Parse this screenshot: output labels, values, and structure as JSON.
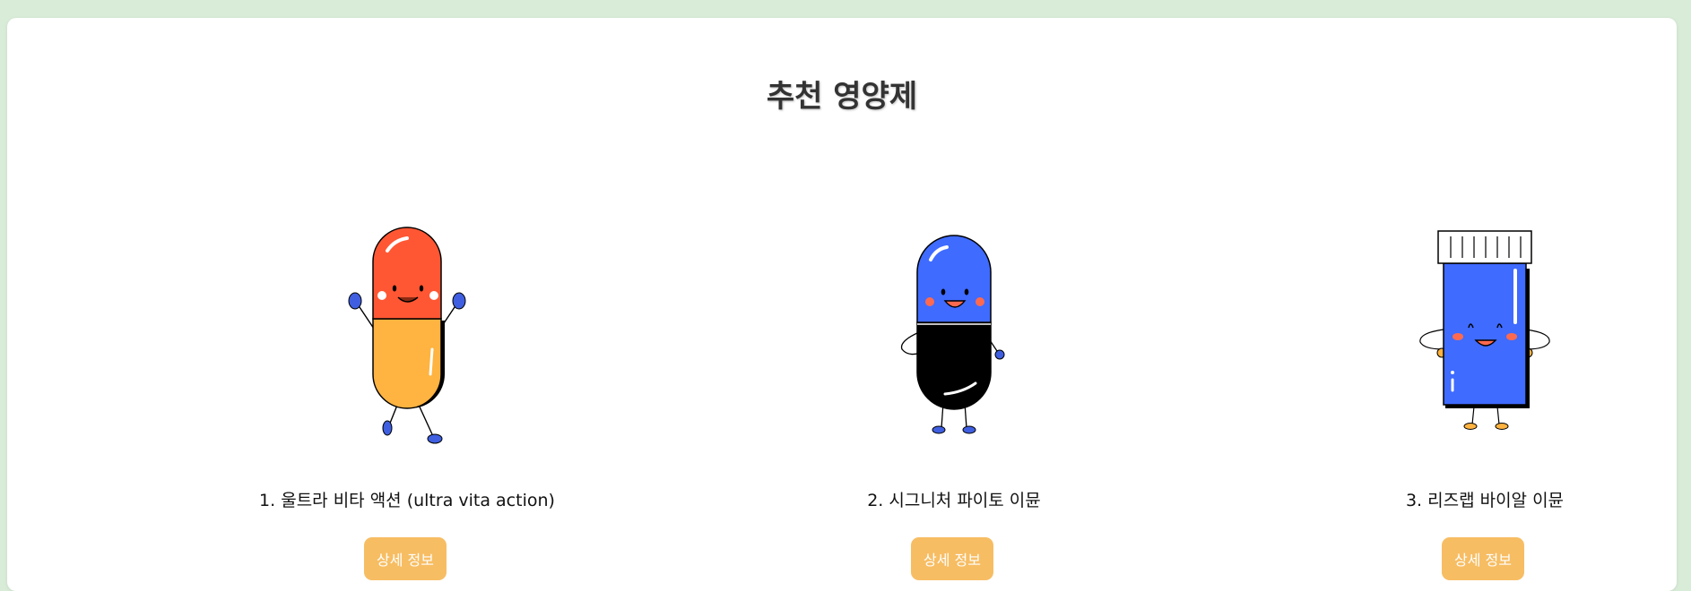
{
  "page": {
    "title": "추천 영양제"
  },
  "products": [
    {
      "name": "1. 울트라 비타 액션 (ultra vita action)",
      "button_label": "상세 정보",
      "icon": "red-yellow-capsule-character-icon"
    },
    {
      "name": "2. 시그니처 파이토 이뮨",
      "button_label": "상세 정보",
      "icon": "blue-black-capsule-character-icon"
    },
    {
      "name": "3. 리즈랩 바이알 이뮨",
      "button_label": "상세 정보",
      "icon": "blue-bottle-character-icon"
    }
  ],
  "colors": {
    "background": "#d8ecd8",
    "card": "#ffffff",
    "button": "#f7bd63",
    "capsule_red": "#ff5733",
    "capsule_yellow": "#ffb340",
    "capsule_blue": "#3f6bff",
    "capsule_black": "#000000"
  }
}
